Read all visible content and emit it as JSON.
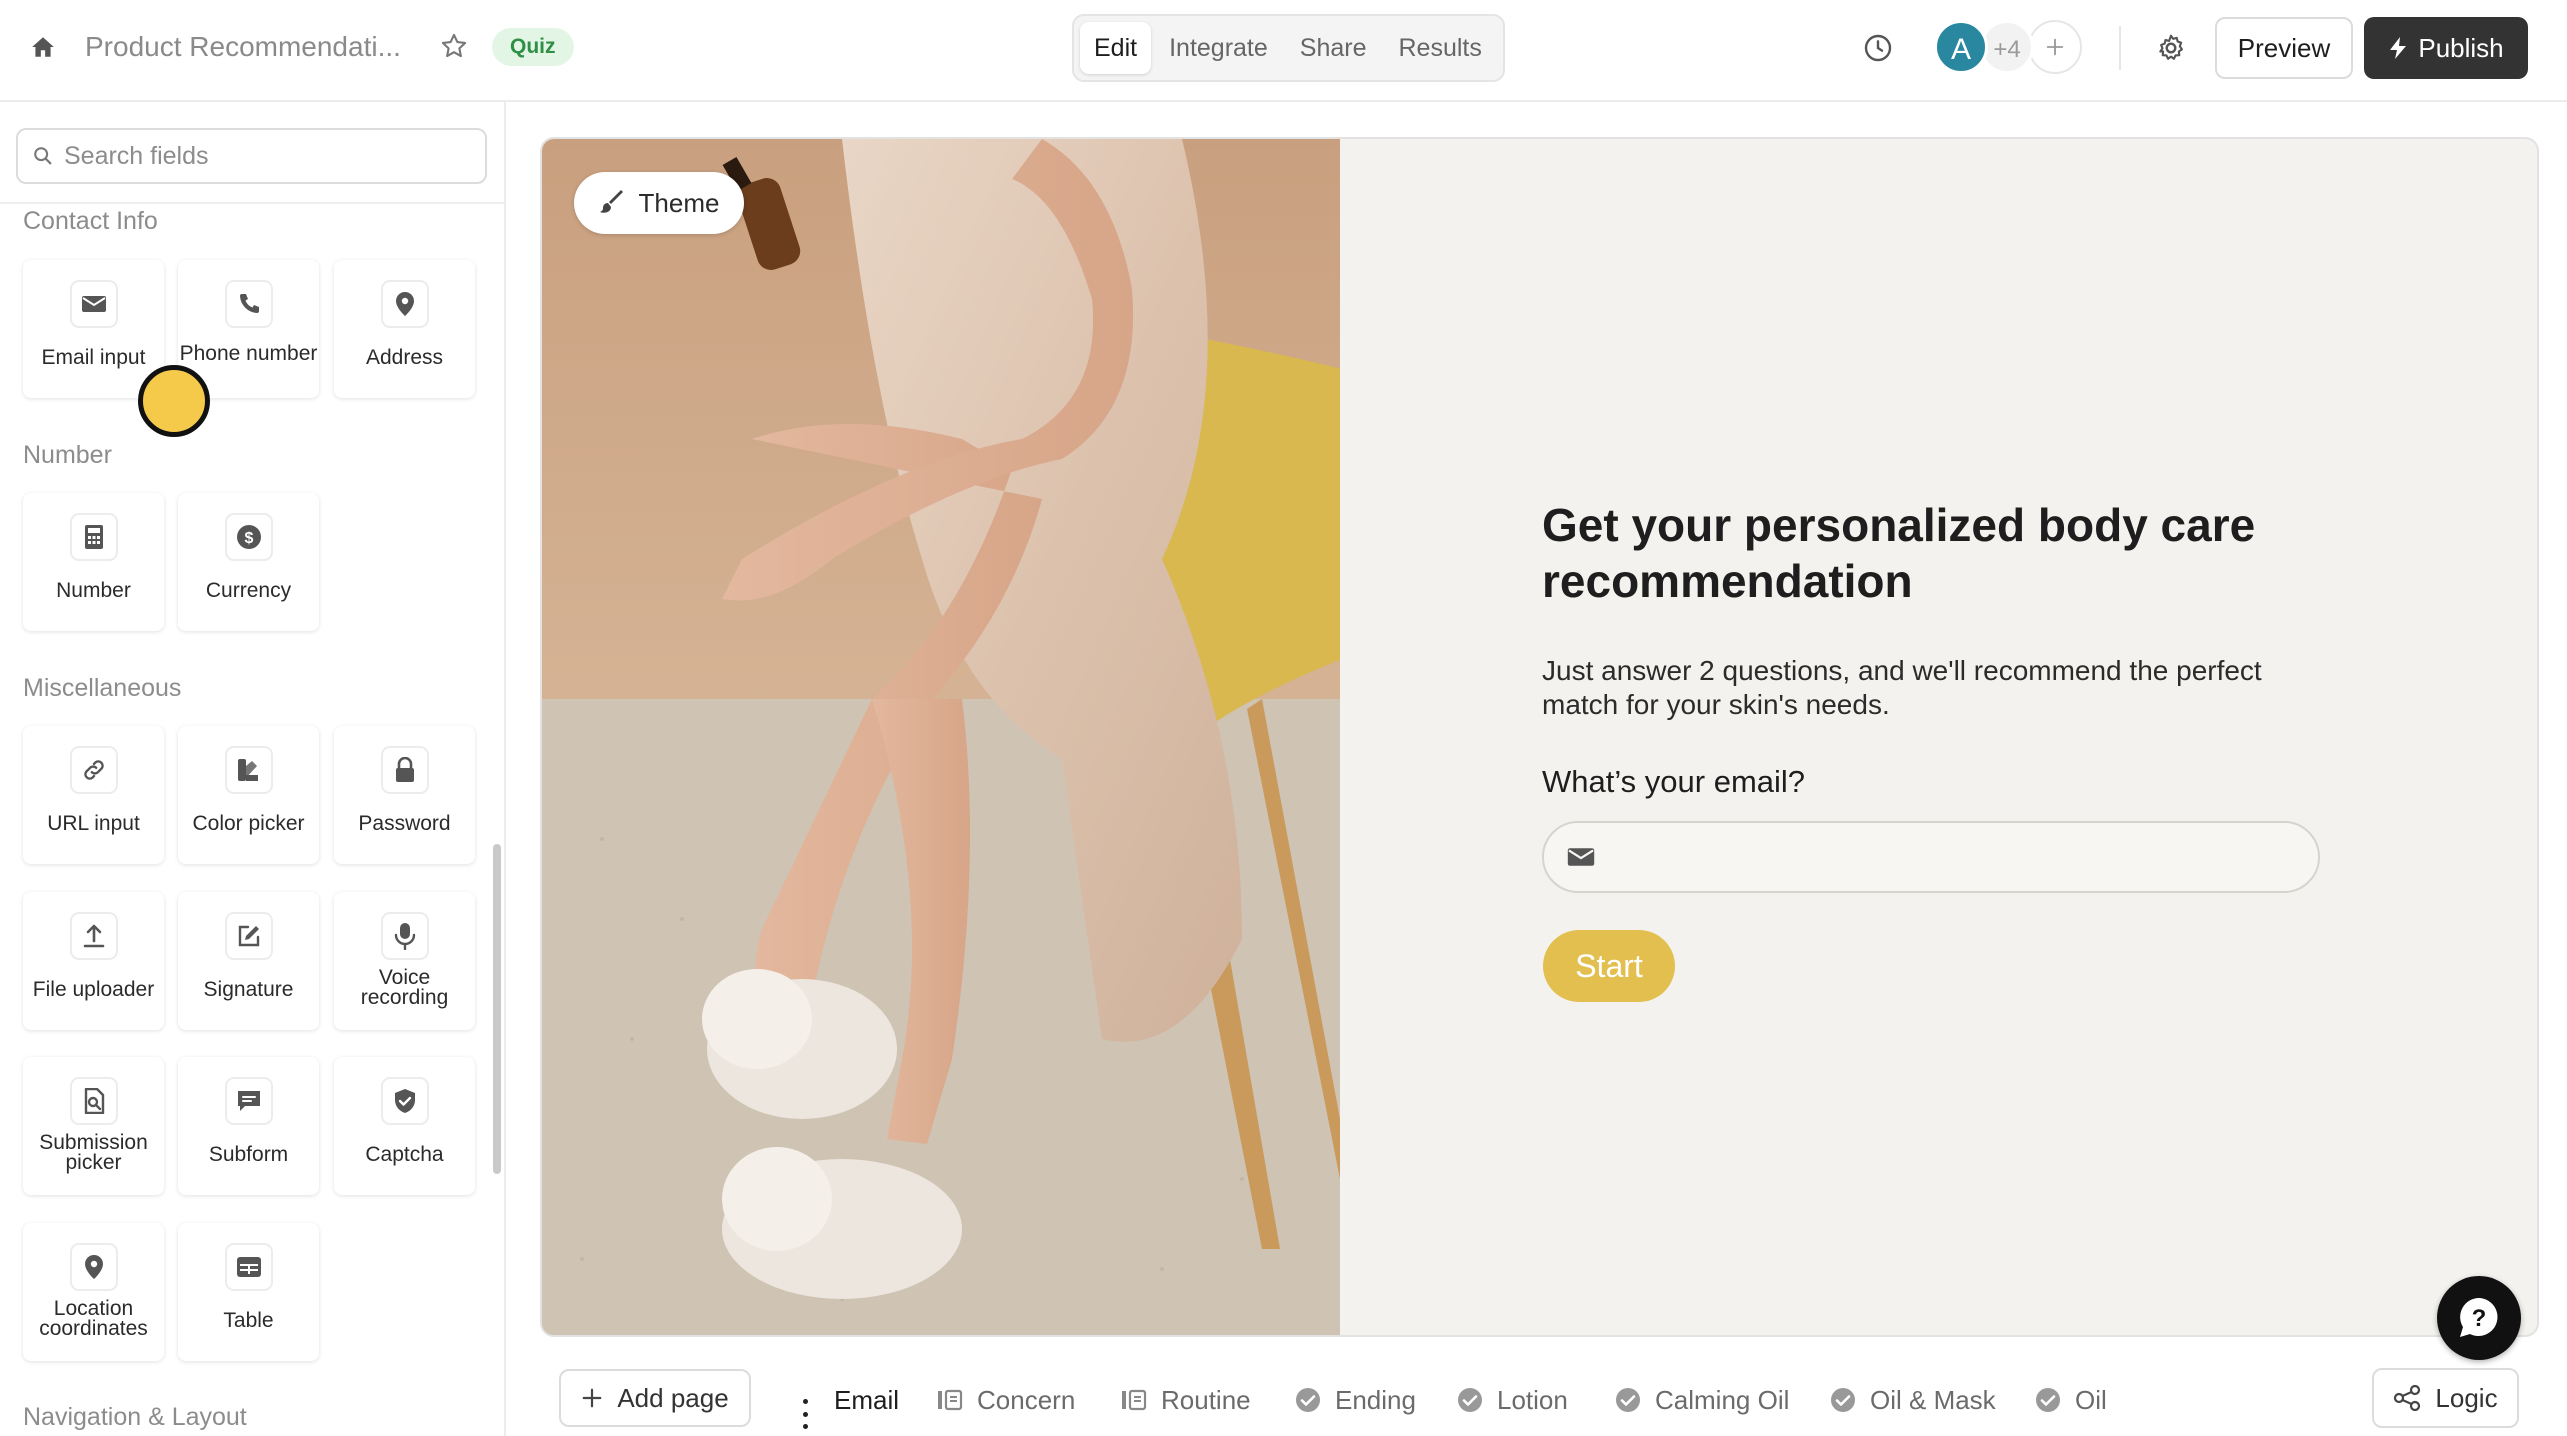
{
  "header": {
    "form_title": "Product Recommendati...",
    "badge": "Quiz",
    "modes": [
      "Edit",
      "Integrate",
      "Share",
      "Results"
    ],
    "active_mode": "Edit",
    "avatar_initial": "A",
    "avatar_more": "+4",
    "preview_label": "Preview",
    "publish_label": "Publish"
  },
  "sidebar": {
    "search_placeholder": "Search fields",
    "sections": {
      "contact": "Contact Info",
      "number": "Number",
      "misc": "Miscellaneous",
      "nav": "Navigation & Layout"
    },
    "fields": {
      "email": "Email input",
      "phone": "Phone number",
      "address": "Address",
      "number": "Number",
      "currency": "Currency",
      "url": "URL input",
      "color": "Color picker",
      "password": "Password",
      "file": "File uploader",
      "signature": "Signature",
      "voice": "Voice recording",
      "submission": "Submission picker",
      "subform": "Subform",
      "captcha": "Captcha",
      "location": "Location coordinates",
      "table": "Table"
    }
  },
  "canvas": {
    "theme_label": "Theme",
    "headline": "Get your personalized body care recommendation",
    "subtext": "Just answer 2 questions, and we'll recommend the perfect match for your skin's needs.",
    "question": "What’s your email?",
    "start_label": "Start",
    "accent_color": "#e3bf4f",
    "background_color": "#f4f2ee"
  },
  "footer": {
    "add_page_label": "Add page",
    "pages": [
      "Email",
      "Concern",
      "Routine",
      "Ending",
      "Lotion",
      "Calming Oil",
      "Oil & Mask",
      "Oil"
    ],
    "logic_label": "Logic"
  }
}
